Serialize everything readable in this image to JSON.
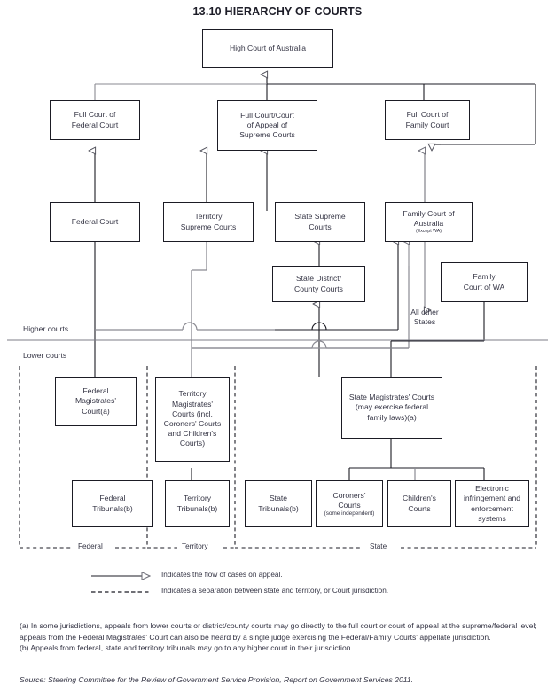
{
  "title": "13.10   HIERARCHY OF COURTS",
  "nodes": {
    "high_court": "High Court of Australia",
    "full_federal": "Full Court of\nFederal Court",
    "full_supreme": "Full Court/Court\nof Appeal of\nSupreme Courts",
    "full_family": "Full Court of\nFamily Court",
    "federal_court": "Federal Court",
    "territory_supreme": "Territory\nSupreme Courts",
    "state_supreme": "State Supreme\nCourts",
    "family_court_aus": "Family Court of\nAustralia",
    "family_court_aus_sub": "(Except WA)",
    "state_district": "State District/\nCounty Courts",
    "family_court_wa": "Family\nCourt of WA",
    "all_other_states": "All other\nStates",
    "federal_magistrates": "Federal\nMagistrates'\nCourt(a)",
    "territory_magistrates": "Territory\nMagistrates'\nCourts (incl.\nCoroners' Courts\nand Children's\nCourts)",
    "state_magistrates": "State Magistrates' Courts\n(may exercise federal\nfamily laws)(a)",
    "federal_tribunals": "Federal\nTribunals(b)",
    "territory_tribunals": "Territory\nTribunals(b)",
    "state_tribunals": "State\nTribunals(b)",
    "coroners_courts": "Coroners'\nCourts",
    "coroners_courts_sub": "(some independent)",
    "childrens_courts": "Children's\nCourts",
    "electronic_infringement": "Electronic\ninfringement and\nenforcement\nsystems"
  },
  "axis_labels": {
    "higher_courts": "Higher courts",
    "lower_courts": "Lower courts"
  },
  "zone_labels": {
    "federal": "Federal",
    "territory": "Territory",
    "state": "State"
  },
  "legend": {
    "arrow_line": "Indicates the flow of cases on appeal.",
    "dashed_line": "Indicates a separation between state and territory, or Court jurisdiction."
  },
  "notes": {
    "a": "(a) In some jurisdictions, appeals from lower courts or district/county courts may go directly to the full court or court of appeal at the supreme/federal level; appeals from the Federal Magistrates' Court can also be heard by a single judge exercising the Federal/Family Courts' appellate jurisdiction.",
    "b": "(b) Appeals from federal, state and territory tribunals may go to any higher court in their jurisdiction."
  },
  "source": "Source: Steering Committee for the Review of Government Service Provision, Report on Government Services 2011.",
  "colors": {
    "box_border": "#1b1b24",
    "text": "#343444",
    "connector_dark": "#1b1b24",
    "connector_grey": "#8a8a92",
    "background": "#ffffff"
  },
  "chart_data": {
    "type": "diagram",
    "title": "13.10   HIERARCHY OF COURTS",
    "levels": [
      {
        "name": "apex",
        "nodes": [
          "High Court of Australia"
        ]
      },
      {
        "name": "appellate",
        "nodes": [
          "Full Court of Federal Court",
          "Full Court/Court of Appeal of Supreme Courts",
          "Full Court of Family Court"
        ]
      },
      {
        "name": "higher",
        "nodes": [
          "Federal Court",
          "Territory Supreme Courts",
          "State Supreme Courts",
          "Family Court of Australia (Except WA)",
          "State District/County Courts",
          "Family Court of WA"
        ]
      },
      {
        "name": "lower",
        "nodes": [
          "Federal Magistrates' Court(a)",
          "Territory Magistrates' Courts (incl. Coroners' Courts and Children's Courts)",
          "State Magistrates' Courts (may exercise federal family laws)(a)"
        ]
      },
      {
        "name": "tribunals",
        "nodes": [
          "Federal Tribunals(b)",
          "Territory Tribunals(b)",
          "State Tribunals(b)",
          "Coroners' Courts (some independent)",
          "Children's Courts",
          "Electronic infringement and enforcement systems"
        ]
      }
    ],
    "edges": [
      {
        "from": "Full Court of Federal Court",
        "to": "High Court of Australia"
      },
      {
        "from": "Full Court/Court of Appeal of Supreme Courts",
        "to": "High Court of Australia"
      },
      {
        "from": "Full Court of Family Court",
        "to": "High Court of Australia"
      },
      {
        "from": "Federal Court",
        "to": "Full Court of Federal Court"
      },
      {
        "from": "Territory Supreme Courts",
        "to": "Full Court/Court of Appeal of Supreme Courts"
      },
      {
        "from": "State Supreme Courts",
        "to": "Full Court/Court of Appeal of Supreme Courts"
      },
      {
        "from": "Family Court of Australia",
        "to": "Full Court of Family Court"
      },
      {
        "from": "Family Court of WA",
        "to": "Full Court of Family Court"
      },
      {
        "from": "State District/County Courts",
        "to": "State Supreme Courts"
      },
      {
        "from": "Federal Magistrates' Court(a)",
        "to": "Federal Court"
      },
      {
        "from": "Territory Magistrates' Courts",
        "to": "Territory Supreme Courts"
      },
      {
        "from": "State Magistrates' Courts",
        "to": "State District/County Courts"
      },
      {
        "from": "State Magistrates' Courts",
        "to": "Family Court of Australia"
      },
      {
        "from": "Family Court of Australia",
        "to": "All other States"
      }
    ],
    "jurisdictions": [
      "Federal",
      "Territory",
      "State"
    ],
    "divider": "Higher courts / Lower courts"
  }
}
